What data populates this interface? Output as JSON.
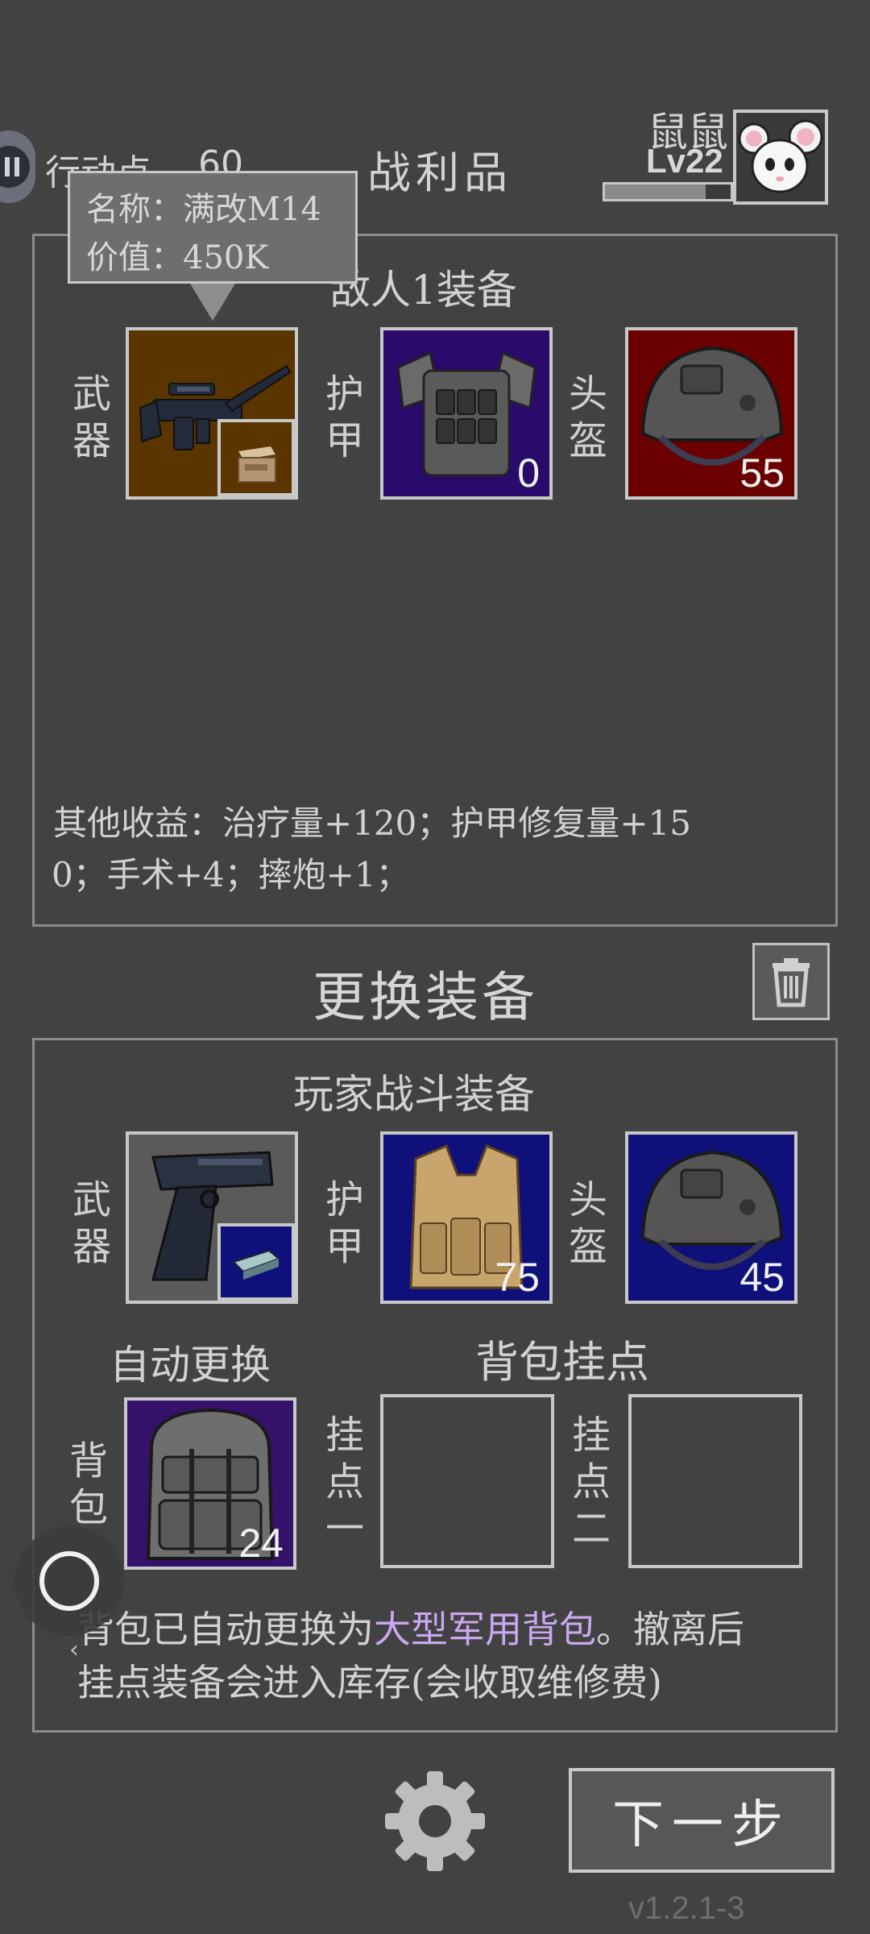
{
  "top": {
    "action_label": "行动点",
    "action_value": "60",
    "title": "战利品",
    "player_name": "鼠鼠",
    "player_level": "Lv22",
    "level_progress": 0.8
  },
  "tooltip": {
    "name_line": "名称：满改M14",
    "value_line": "价值：450K"
  },
  "loot": {
    "header": "敌人1装备",
    "weapon_label": "武器",
    "armor_label": "护甲",
    "helmet_label": "头盔",
    "armor_value": "0",
    "helmet_value": "55",
    "other_gains_line1": "其他收益：治疗量+120；护甲修复量+15",
    "other_gains_line2": "0；手术+4；摔炮+1；"
  },
  "swap": {
    "title": "更换装备",
    "header": "玩家战斗装备",
    "weapon_label": "武器",
    "armor_label": "护甲",
    "helmet_label": "头盔",
    "armor_value": "75",
    "helmet_value": "45",
    "auto_swap": "自动更换",
    "attach_title": "背包挂点",
    "backpack_label": "背包",
    "backpack_value": "24",
    "attach1_label": "挂点一",
    "attach2_label": "挂点二",
    "note_prefix": "背包已自动更换为",
    "note_highlight": "大型军用背包",
    "note_suffix": "。撤离后",
    "note_line2": "挂点装备会进入库存(会收取维修费)"
  },
  "footer": {
    "next_button": "下一步",
    "version": "v1.2.1-3"
  },
  "colors": {
    "background": "#424242",
    "weapon_slot_bg": "#5a3500",
    "armor_slot_bg": "#2a0a6b",
    "helmet_slot_bg": "#6b0000",
    "player_slot_bg": "#10107a",
    "highlight_text": "#c9a8f0"
  }
}
